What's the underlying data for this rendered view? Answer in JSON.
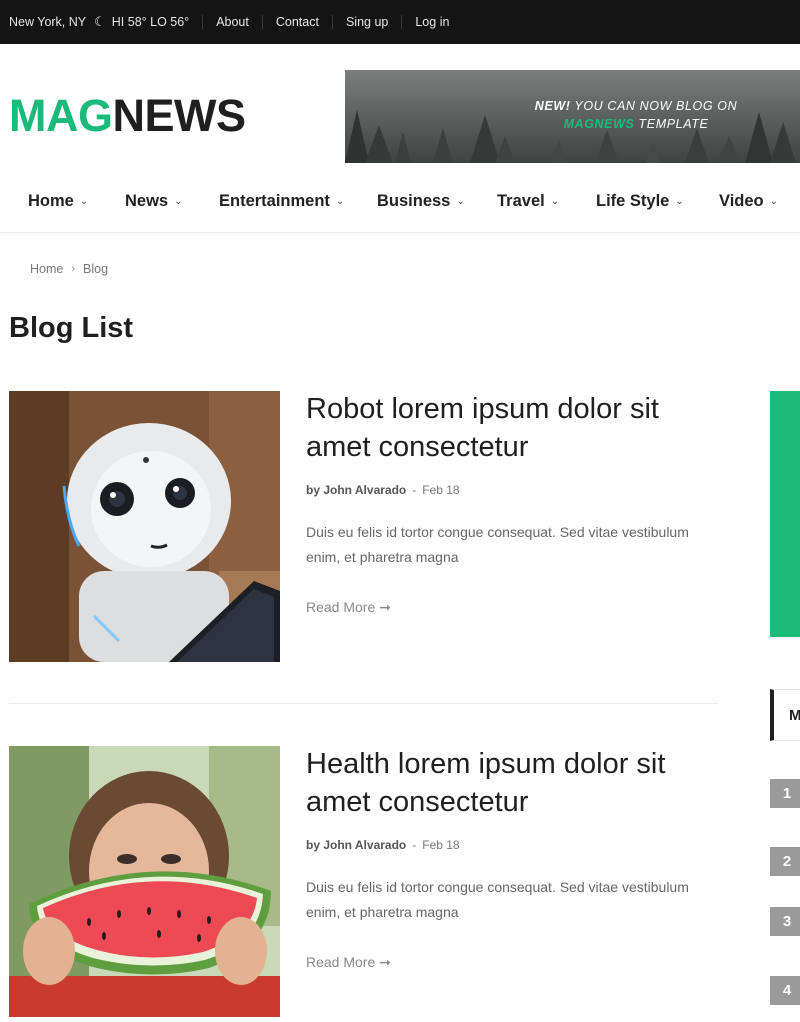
{
  "topbar": {
    "location": "New York, NY",
    "weather": "HI 58° LO 56°",
    "weather_icon": "moon-icon",
    "links": [
      "About",
      "Contact",
      "Sing up",
      "Log in"
    ]
  },
  "logo": {
    "part1": "MAG",
    "part2": "NEWS"
  },
  "banner": {
    "new": "NEW!",
    "line1": "YOU CAN NOW BLOG ON",
    "brand": "MAGNEWS",
    "line2": "TEMPLATE"
  },
  "nav": {
    "items": [
      {
        "label": "Home"
      },
      {
        "label": "News"
      },
      {
        "label": "Entertainment"
      },
      {
        "label": "Business"
      },
      {
        "label": "Travel"
      },
      {
        "label": "Life Style"
      },
      {
        "label": "Video"
      }
    ]
  },
  "breadcrumb": {
    "home": "Home",
    "current": "Blog"
  },
  "page_title": "Blog List",
  "posts": [
    {
      "title": "Robot lorem ipsum dolor sit amet consectetur",
      "author": "by John Alvarado",
      "date": "Feb 18",
      "excerpt": "Duis eu felis id tortor congue consequat. Sed vitae vestibulum enim, et pharetra magna",
      "read_more": "Read More"
    },
    {
      "title": "Health lorem ipsum dolor sit amet consectetur",
      "author": "by John Alvarado",
      "date": "Feb 18",
      "excerpt": "Duis eu felis id tortor congue consequat. Sed vitae vestibulum enim, et pharetra magna",
      "read_more": "Read More"
    }
  ],
  "sidebar": {
    "heading_initial": "M",
    "numbers": [
      "1",
      "2",
      "3",
      "4"
    ]
  },
  "colors": {
    "accent": "#1bba7a",
    "topbar": "#141414"
  }
}
